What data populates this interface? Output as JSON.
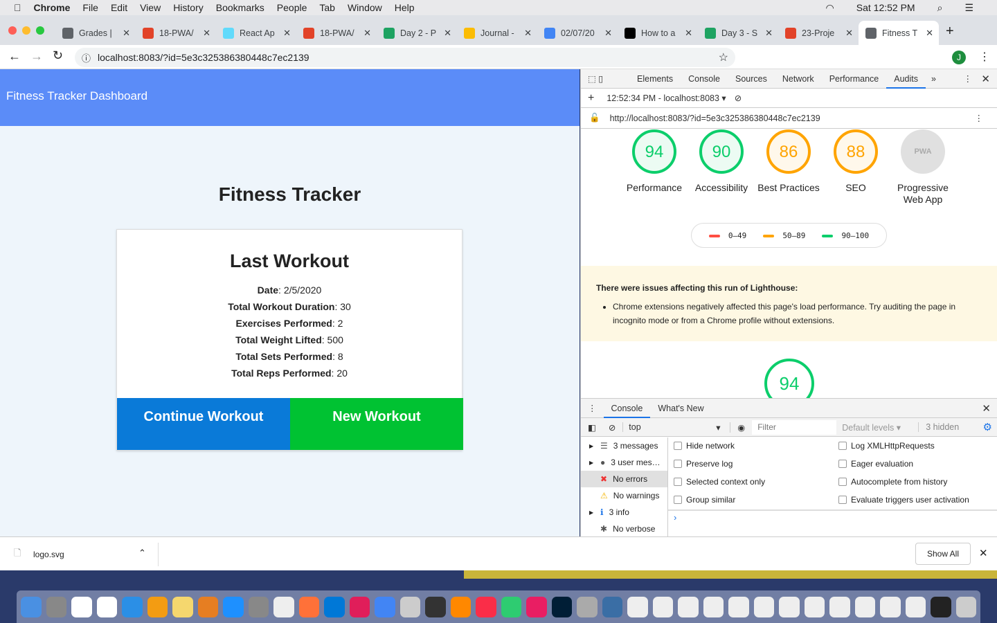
{
  "menubar": {
    "app": "Chrome",
    "items": [
      "File",
      "Edit",
      "View",
      "History",
      "Bookmarks",
      "People",
      "Tab",
      "Window",
      "Help"
    ],
    "clock": "Sat 12:52 PM"
  },
  "tabs": [
    {
      "label": "Grades |",
      "color": "#5f6368"
    },
    {
      "label": "18-PWA/",
      "color": "#e24329"
    },
    {
      "label": "React Ap",
      "color": "#61dafb"
    },
    {
      "label": "18-PWA/",
      "color": "#e24329"
    },
    {
      "label": "Day 2 - P",
      "color": "#1ea362"
    },
    {
      "label": "Journal -",
      "color": "#fbbc04"
    },
    {
      "label": "02/07/20",
      "color": "#4285f4"
    },
    {
      "label": "How to a",
      "color": "#000000"
    },
    {
      "label": "Day 3 - S",
      "color": "#1ea362"
    },
    {
      "label": "23-Proje",
      "color": "#e24329"
    },
    {
      "label": "Fitness T",
      "color": "#5f6368",
      "active": true
    }
  ],
  "address": {
    "url": "localhost:8083/?id=5e3c325386380448c7ec2139",
    "profile": "J"
  },
  "page": {
    "header": "Fitness Tracker Dashboard",
    "title": "Fitness Tracker",
    "card_title": "Last Workout",
    "rows": [
      {
        "k": "Date",
        "v": "2/5/2020"
      },
      {
        "k": "Total Workout Duration",
        "v": "30"
      },
      {
        "k": "Exercises Performed",
        "v": "2"
      },
      {
        "k": "Total Weight Lifted",
        "v": "500"
      },
      {
        "k": "Total Sets Performed",
        "v": "8"
      },
      {
        "k": "Total Reps Performed",
        "v": "20"
      }
    ],
    "continue": "Continue Workout",
    "new": "New Workout",
    "colors": {
      "header": "#5b8cf8",
      "continue": "#0a7ad8",
      "new": "#00c232"
    }
  },
  "devtools": {
    "tabs": [
      "Elements",
      "Console",
      "Sources",
      "Network",
      "Performance",
      "Audits"
    ],
    "active": "Audits",
    "run": "12:52:34 PM - localhost:8083 ▾",
    "url": "http://localhost:8083/?id=5e3c325386380448c7ec2139",
    "scores": [
      {
        "label": "Performance",
        "value": "94",
        "color": "#0cce6b"
      },
      {
        "label": "Accessibility",
        "value": "90",
        "color": "#0cce6b"
      },
      {
        "label": "Best Practices",
        "value": "86",
        "color": "#ffa400"
      },
      {
        "label": "SEO",
        "value": "88",
        "color": "#ffa400"
      },
      {
        "label": "Progressive Web App",
        "value": "PWA",
        "color": "#999999"
      }
    ],
    "legend": [
      "0–49",
      "50–89",
      "90–100"
    ],
    "warn_title": "There were issues affecting this run of Lighthouse:",
    "warn_item": "Chrome extensions negatively affected this page's load performance. Try auditing the page in incognito mode or from a Chrome profile without extensions.",
    "big_score": "94",
    "drawer": {
      "tabs": [
        "Console",
        "What's New"
      ],
      "context": "top",
      "filter_placeholder": "Filter",
      "levels": "Default levels ▾",
      "hidden": "3 hidden",
      "side": [
        "3 messages",
        "3 user mes…",
        "No errors",
        "No warnings",
        "3 info",
        "No verbose"
      ],
      "checks_left": [
        "Hide network",
        "Preserve log",
        "Selected context only",
        "Group similar"
      ],
      "checks_right": [
        "Log XMLHttpRequests",
        "Eager evaluation",
        "Autocomplete from history",
        "Evaluate triggers user activation"
      ]
    }
  },
  "download": {
    "file": "logo.svg",
    "show_all": "Show All"
  }
}
